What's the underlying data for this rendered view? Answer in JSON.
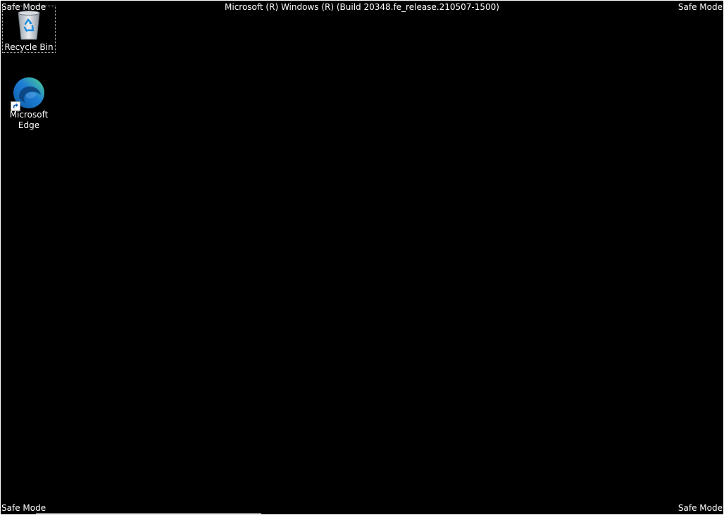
{
  "watermarks": {
    "top_left": "Safe Mode",
    "top_right": "Safe Mode",
    "bottom_left": "Safe Mode",
    "bottom_right": "Safe Mode",
    "title": "Microsoft (R) Windows (R) (Build 20348.fe_release.210507-1500)"
  },
  "desktop_icons": [
    {
      "label": "Recycle Bin",
      "icon": "recycle-bin-icon",
      "selected": true
    },
    {
      "label": "Microsoft Edge",
      "icon": "edge-icon",
      "shortcut": true
    }
  ],
  "colors": {
    "desktop_background": "#000000",
    "text": "#ffffff",
    "edge_blue": "#1e7fd6",
    "edge_green": "#4fd38c"
  }
}
